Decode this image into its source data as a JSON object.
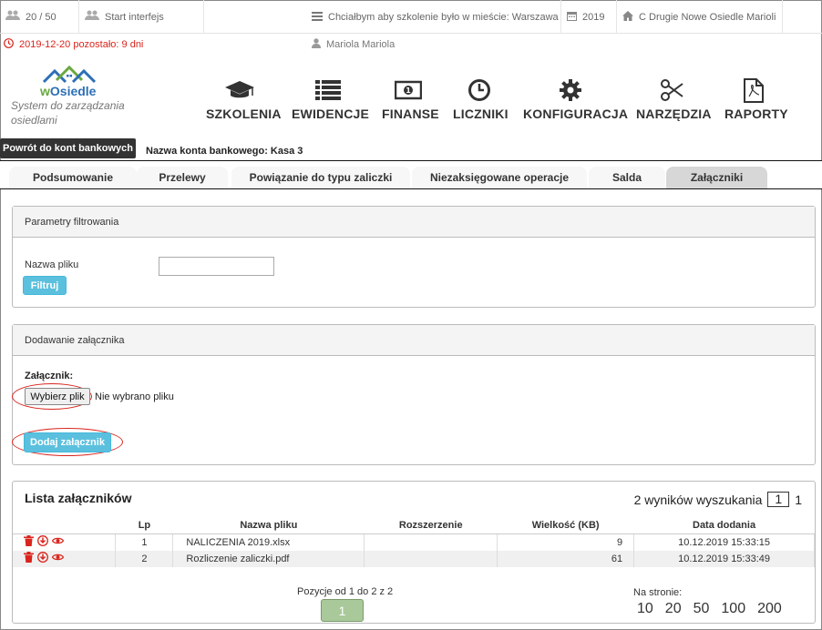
{
  "topbar": {
    "users_count": "20 / 50",
    "start_interface": "Start interfejs",
    "message": "Chciałbym aby szkolenie było w mieście: Warszawa",
    "year": "2019",
    "community": "C Drugie Nowe Osiedle Marioli",
    "deadline": "2019-12-20 pozostało: 9 dni",
    "user_name": "Mariola Mariola"
  },
  "logo": {
    "name_prefix": "w",
    "name_rest": "Osiedle",
    "tagline": "System do zarządzania osiedlami"
  },
  "menu": [
    {
      "label": "SZKOLENIA",
      "icon": "graduation-cap-icon"
    },
    {
      "label": "EWIDENCJE",
      "icon": "list-icon"
    },
    {
      "label": "FINANSE",
      "icon": "money-icon"
    },
    {
      "label": "LICZNIKI",
      "icon": "clock-icon"
    },
    {
      "label": "KONFIGURACJA",
      "icon": "gear-icon"
    },
    {
      "label": "NARZĘDZIA",
      "icon": "scissors-icon"
    },
    {
      "label": "RAPORTY",
      "icon": "pdf-icon"
    }
  ],
  "back_button": "Powrót do kont bankowych",
  "account": {
    "label": "Nazwa konta bankowego:",
    "value": "Kasa 3"
  },
  "tabs": [
    "Podsumowanie",
    "Przelewy",
    "Powiązanie do typu zaliczki",
    "Niezaksięgowane operacje",
    "Salda",
    "Załączniki"
  ],
  "active_tab": "Załączniki",
  "filter": {
    "title": "Parametry filtrowania",
    "file_name_label": "Nazwa pliku",
    "file_name_value": "",
    "filter_button": "Filtruj"
  },
  "upload": {
    "title": "Dodawanie załącznika",
    "attachment_label": "Załącznik:",
    "choose_button": "Wybierz plik",
    "no_file": "Nie wybrano pliku",
    "add_button": "Dodaj załącznik"
  },
  "list": {
    "title": "Lista załączników",
    "results_text": "2 wyników wyszukania",
    "current_page": "1",
    "total_pages": "1",
    "columns": [
      "",
      "Lp",
      "Nazwa pliku",
      "Rozszerzenie",
      "Wielkość (KB)",
      "Data dodania"
    ],
    "rows": [
      {
        "lp": "1",
        "name": "NALICZENIA 2019.xlsx",
        "ext": "",
        "size": "9",
        "date": "10.12.2019 15:33:15"
      },
      {
        "lp": "2",
        "name": "Rozliczenie zaliczki.pdf",
        "ext": "",
        "size": "61",
        "date": "10.12.2019 15:33:49"
      }
    ],
    "position_text": "Pozycje od 1 do 2 z 2",
    "page_button": "1",
    "per_page_label": "Na stronie:",
    "per_page_options": [
      "10",
      "20",
      "50",
      "100",
      "200"
    ]
  },
  "colors": {
    "accent_blue": "#5bc0de",
    "danger_red": "#d9251d",
    "pager_green": "#a9c99a"
  }
}
